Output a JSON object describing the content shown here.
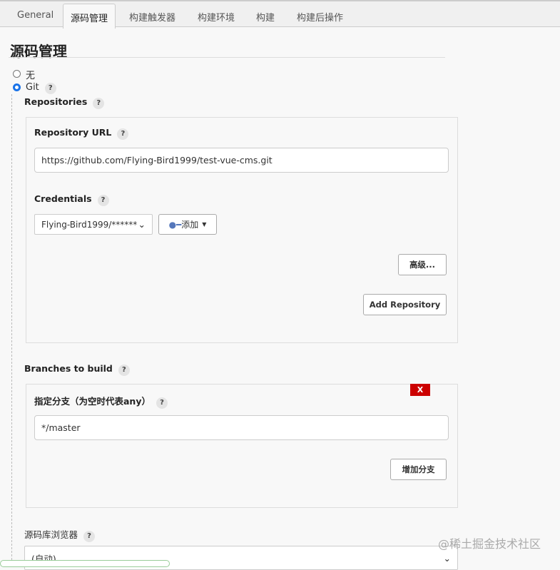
{
  "tabs": [
    "General",
    "源码管理",
    "构建触发器",
    "构建环境",
    "构建",
    "构建后操作"
  ],
  "section_title": "源码管理",
  "scm": {
    "none_label": "无",
    "git_label": "Git",
    "selected": "Git"
  },
  "repositories_label": "Repositories",
  "repo": {
    "url_label": "Repository URL",
    "url_value": "https://github.com/Flying-Bird1999/test-vue-cms.git",
    "credentials_label": "Credentials",
    "credentials_value": "Flying-Bird1999/******",
    "add_label": "添加",
    "advanced_label": "高级...",
    "add_repository_label": "Add Repository"
  },
  "branches": {
    "label": "Branches to build",
    "delete_label": "X",
    "branch_label": "指定分支（为空时代表any）",
    "branch_value": "*/master",
    "add_branch_label": "增加分支"
  },
  "browser": {
    "label": "源码库浏览器",
    "value": "(自动)"
  },
  "help": "?",
  "watermark": "@稀土掘金技术社区"
}
